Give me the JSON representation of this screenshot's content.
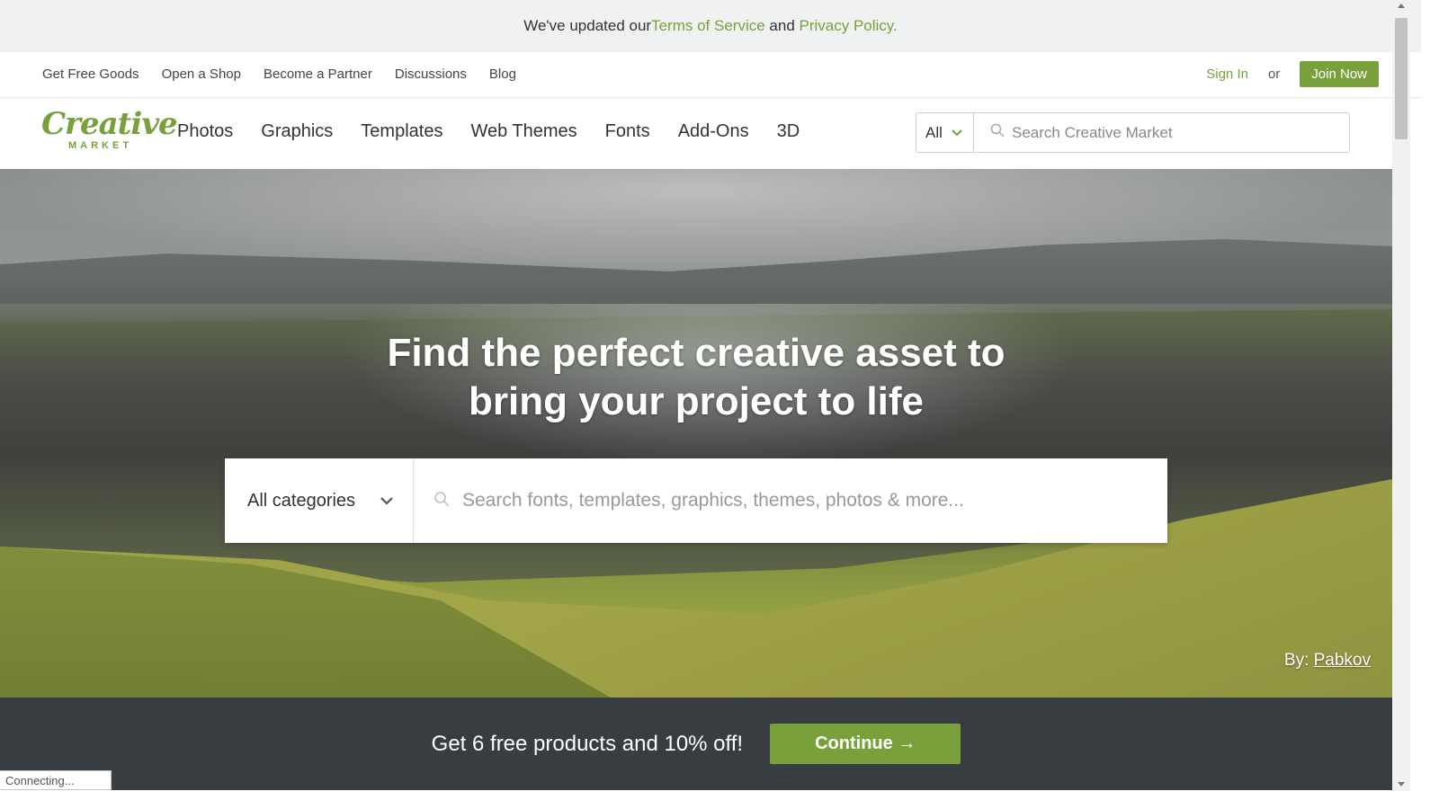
{
  "notice": {
    "prefix": "We've updated our ",
    "terms": "Terms of Service",
    "and": " and ",
    "privacy": "Privacy Policy.",
    "close": "×"
  },
  "util_nav": {
    "links": [
      "Get Free Goods",
      "Open a Shop",
      "Become a Partner",
      "Discussions",
      "Blog"
    ],
    "sign_in": "Sign In",
    "or": "or",
    "join": "Join Now"
  },
  "logo": {
    "top": "Creative",
    "bottom": "MARKET"
  },
  "main_nav": {
    "links": [
      "Photos",
      "Graphics",
      "Templates",
      "Web Themes",
      "Fonts",
      "Add-Ons",
      "3D"
    ]
  },
  "top_search": {
    "category": "All",
    "placeholder": "Search Creative Market"
  },
  "hero": {
    "line1": "Find the perfect creative asset to",
    "line2": "bring your project to life",
    "category": "All categories",
    "placeholder": "Search fonts, templates, graphics, themes, photos & more...",
    "credit_prefix": "By: ",
    "credit_name": "Pabkov"
  },
  "promo": {
    "text": "Get 6 free products and 10% off!",
    "button": "Continue →"
  },
  "status": "Connecting...",
  "colors": {
    "brand_green": "#78a13c",
    "promo_bg": "#373d40",
    "notice_bg": "#f0f1f1"
  }
}
